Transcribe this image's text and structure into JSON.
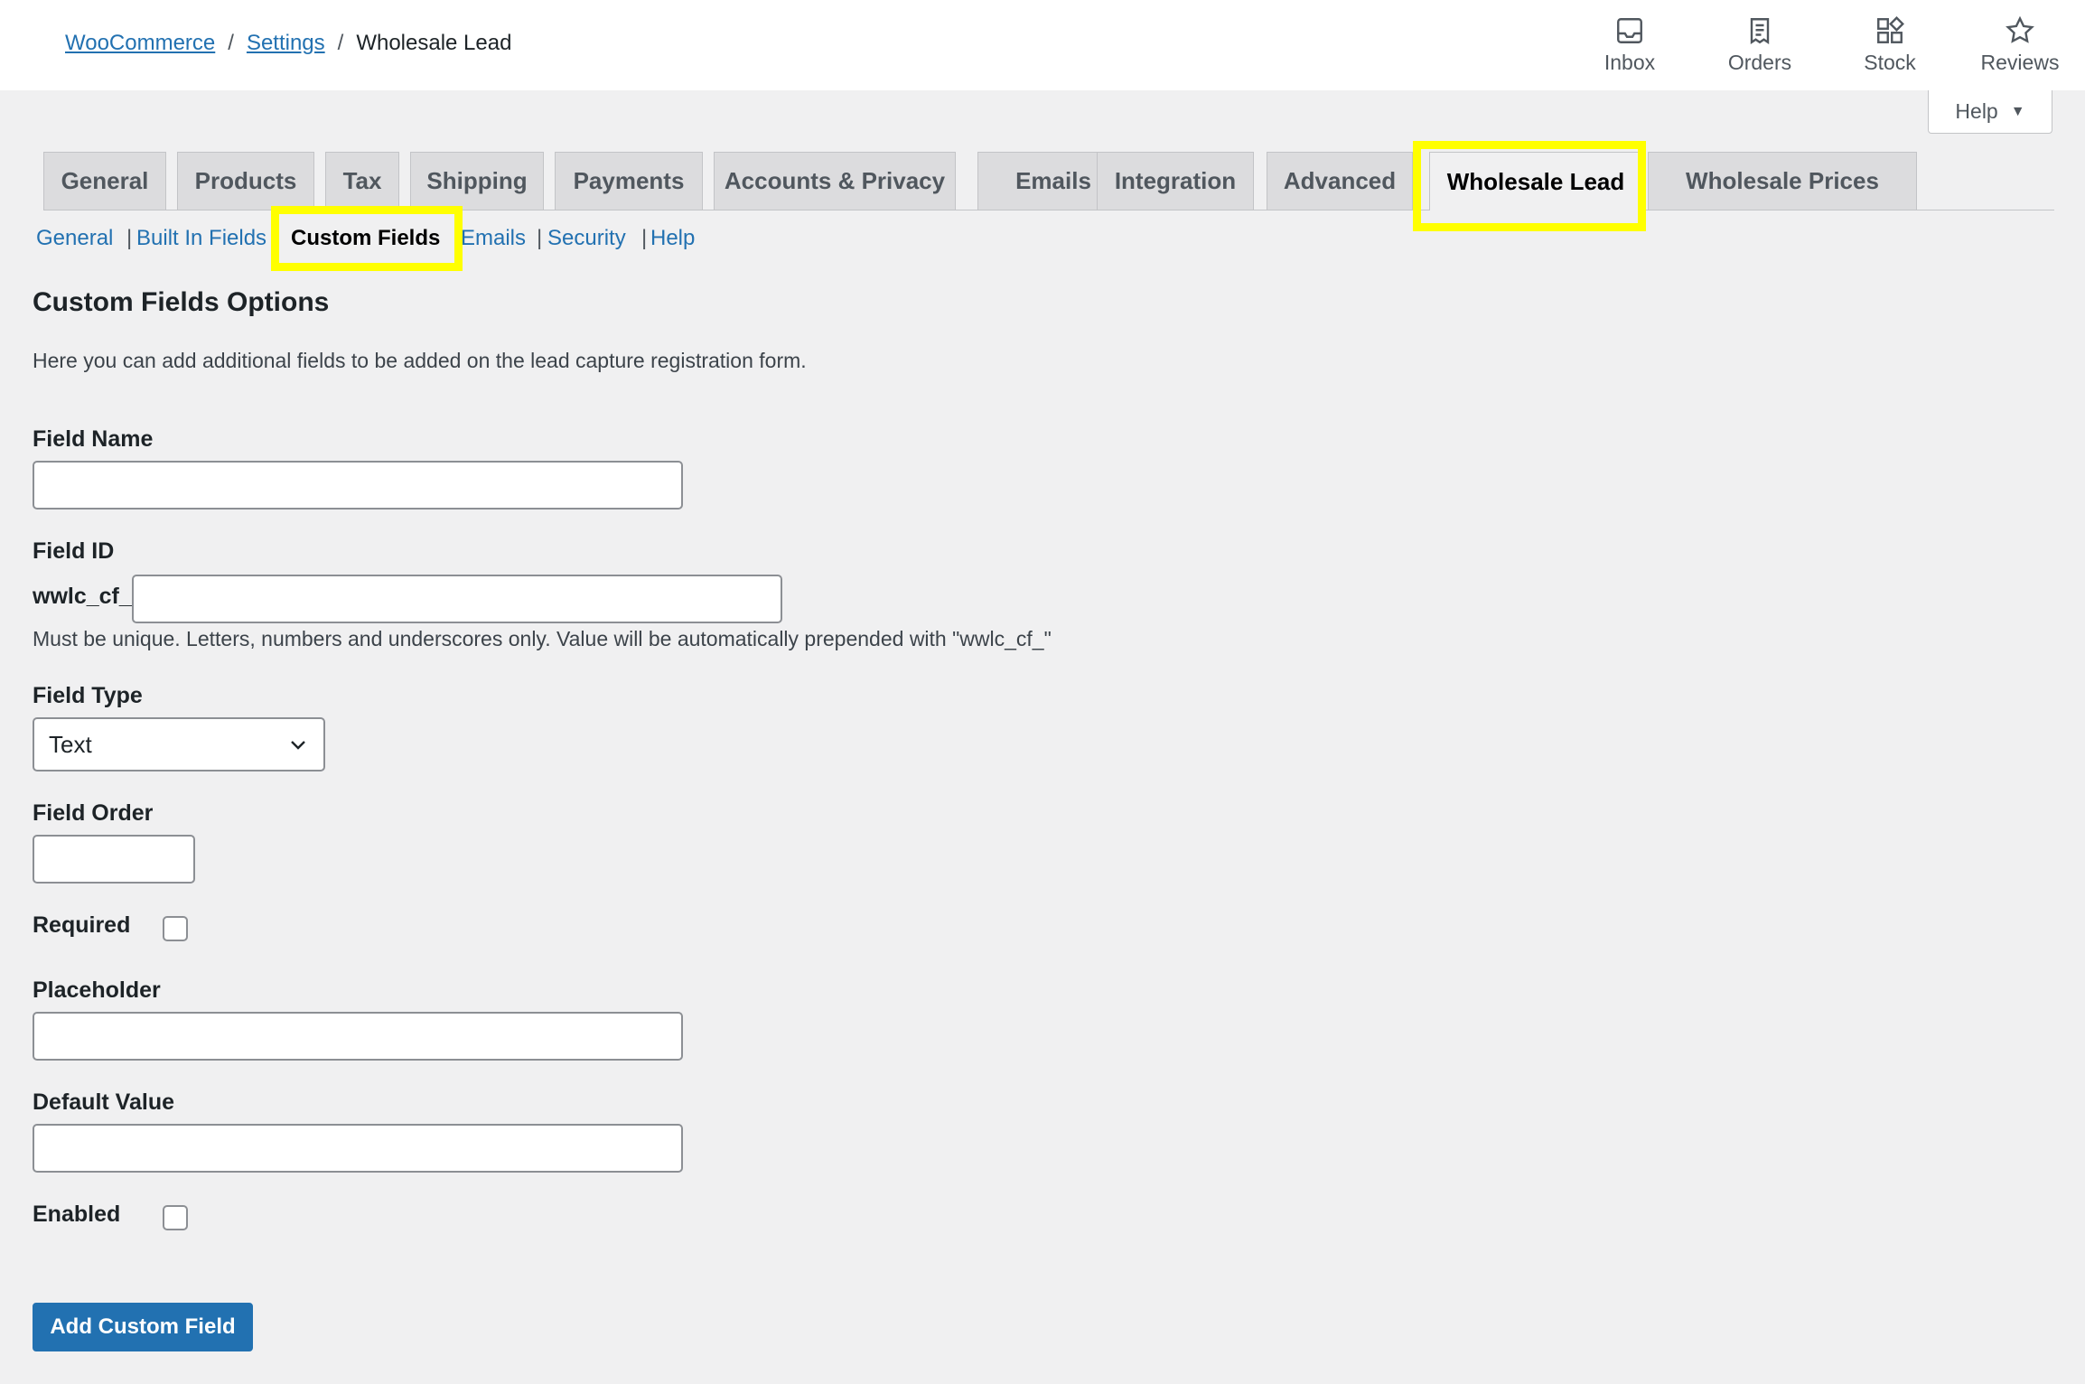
{
  "breadcrumb": {
    "items": [
      {
        "label": "WooCommerce",
        "link": true
      },
      {
        "label": "Settings",
        "link": true
      },
      {
        "label": "Wholesale Lead",
        "link": false
      }
    ],
    "separator": "/"
  },
  "top_actions": [
    {
      "label": "Inbox",
      "icon": "inbox-icon"
    },
    {
      "label": "Orders",
      "icon": "orders-icon"
    },
    {
      "label": "Stock",
      "icon": "stock-icon"
    },
    {
      "label": "Reviews",
      "icon": "star-icon"
    }
  ],
  "help": {
    "label": "Help"
  },
  "tabs": [
    {
      "label": "General"
    },
    {
      "label": "Products"
    },
    {
      "label": "Tax"
    },
    {
      "label": "Shipping"
    },
    {
      "label": "Payments"
    },
    {
      "label": "Accounts & Privacy"
    },
    {
      "label": "Emails"
    },
    {
      "label": "Integration"
    },
    {
      "label": "Advanced"
    },
    {
      "label": "Wholesale Lead",
      "active": true
    },
    {
      "label": "Wholesale Prices"
    }
  ],
  "subnav": [
    {
      "label": "General"
    },
    {
      "label": "Built In Fields"
    },
    {
      "label": "Custom Fields",
      "current": true
    },
    {
      "label": "Emails"
    },
    {
      "label": "Security"
    },
    {
      "label": "Help"
    }
  ],
  "subnav_separator": "|",
  "section": {
    "title": "Custom Fields Options",
    "description": "Here you can add additional fields to be added on the lead capture registration form."
  },
  "form": {
    "field_name": {
      "label": "Field Name",
      "value": ""
    },
    "field_id": {
      "label": "Field ID",
      "prefix": "wwlc_cf_",
      "value": "",
      "hint": "Must be unique. Letters, numbers and underscores only. Value will be automatically prepended with \"wwlc_cf_\""
    },
    "field_type": {
      "label": "Field Type",
      "selected": "Text"
    },
    "field_order": {
      "label": "Field Order",
      "value": ""
    },
    "required": {
      "label": "Required",
      "checked": false
    },
    "placeholder": {
      "label": "Placeholder",
      "value": ""
    },
    "default_value": {
      "label": "Default Value",
      "value": ""
    },
    "enabled": {
      "label": "Enabled",
      "checked": false
    }
  },
  "actions": {
    "add_label": "Add Custom Field"
  },
  "colors": {
    "accent": "#2271b1",
    "highlight": "#ffff00",
    "background": "#f0f0f1"
  }
}
